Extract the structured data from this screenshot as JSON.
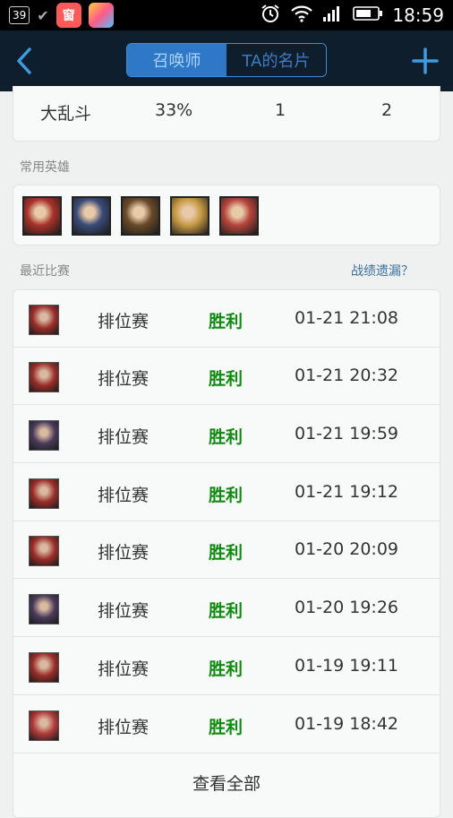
{
  "status_bar": {
    "notif_count": "39",
    "app1_glyph": "窗",
    "time": "18:59"
  },
  "header": {
    "tabs": [
      {
        "label": "召唤师",
        "active": true
      },
      {
        "label": "TA的名片",
        "active": false
      }
    ]
  },
  "stats_row": {
    "mode": "大乱斗",
    "win_rate": "33%",
    "col3": "1",
    "col4": "2"
  },
  "heroes": {
    "section_label": "常用英雄",
    "items": [
      {
        "icon": "hero-portrait-1",
        "color": "#a8332a"
      },
      {
        "icon": "hero-portrait-2",
        "color": "#3a4b78"
      },
      {
        "icon": "hero-portrait-3",
        "color": "#6a4a2a"
      },
      {
        "icon": "hero-portrait-4",
        "color": "#c79a45"
      },
      {
        "icon": "hero-portrait-5",
        "color": "#b5453c"
      }
    ]
  },
  "recent": {
    "section_label": "最近比赛",
    "link_label": "战绩遗漏？",
    "matches": [
      {
        "type": "排位赛",
        "result": "胜利",
        "time": "01-21 21:08",
        "icon_color": "#9a2e2a"
      },
      {
        "type": "排位赛",
        "result": "胜利",
        "time": "01-21 20:32",
        "icon_color": "#9a2e2a"
      },
      {
        "type": "排位赛",
        "result": "胜利",
        "time": "01-21 19:59",
        "icon_color": "#4a3a5a"
      },
      {
        "type": "排位赛",
        "result": "胜利",
        "time": "01-21 19:12",
        "icon_color": "#9a2e2a"
      },
      {
        "type": "排位赛",
        "result": "胜利",
        "time": "01-20 20:09",
        "icon_color": "#9a2e2a"
      },
      {
        "type": "排位赛",
        "result": "胜利",
        "time": "01-20 19:26",
        "icon_color": "#4a3a5a"
      },
      {
        "type": "排位赛",
        "result": "胜利",
        "time": "01-19 19:11",
        "icon_color": "#9a2e2a"
      },
      {
        "type": "排位赛",
        "result": "胜利",
        "time": "01-19 18:42",
        "icon_color": "#b03a3a"
      }
    ],
    "view_all_label": "查看全部"
  }
}
